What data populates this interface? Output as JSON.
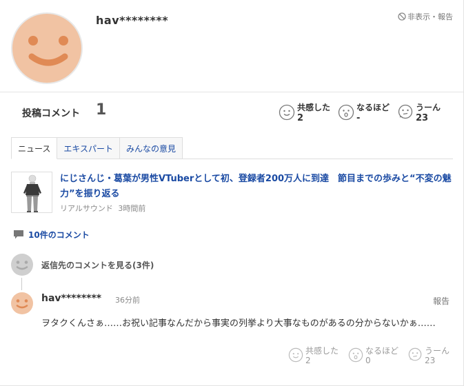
{
  "profile": {
    "username": "hav********",
    "hide_report": "非表示・報告",
    "avatar_icon": "smiley-face-avatar",
    "avatar_color": "#f1c3a3"
  },
  "stats": {
    "post_count_label": "投稿コメント",
    "post_count_value": "1",
    "reactions": [
      {
        "label": "共感した",
        "value": "2",
        "icon": "smile-icon"
      },
      {
        "label": "なるほど",
        "value": "-",
        "icon": "surprised-icon"
      },
      {
        "label": "うーん",
        "value": "23",
        "icon": "hmm-icon"
      }
    ]
  },
  "tabs": [
    {
      "label": "ニュース",
      "active": true
    },
    {
      "label": "エキスパート",
      "active": false
    },
    {
      "label": "みんなの意見",
      "active": false
    }
  ],
  "article": {
    "title": "にじさんじ・葛葉が男性VTuberとして初、登録者200万人に到達　節目までの歩みと“不変の魅力”を振り返る",
    "source": "リアルサウンド",
    "time": "3時間前"
  },
  "comment_count_link": "10件のコメント",
  "thread": {
    "view_replies": "返信先のコメントを見る(3件)"
  },
  "comment": {
    "user": "hav********",
    "time": "36分前",
    "report": "報告",
    "text": "ヲタクくんさぁ……お祝い記事なんだから事実の列挙より大事なものがあるの分からないかぁ……",
    "reactions": [
      {
        "label": "共感した",
        "value": "2",
        "icon": "smile-icon"
      },
      {
        "label": "なるほど",
        "value": "0",
        "icon": "surprised-icon"
      },
      {
        "label": "うーん",
        "value": "23",
        "icon": "hmm-icon"
      }
    ]
  },
  "colors": {
    "link": "#1a4aa3",
    "avatar_skin": "#f1c3a3",
    "avatar_features": "#e08a55"
  }
}
